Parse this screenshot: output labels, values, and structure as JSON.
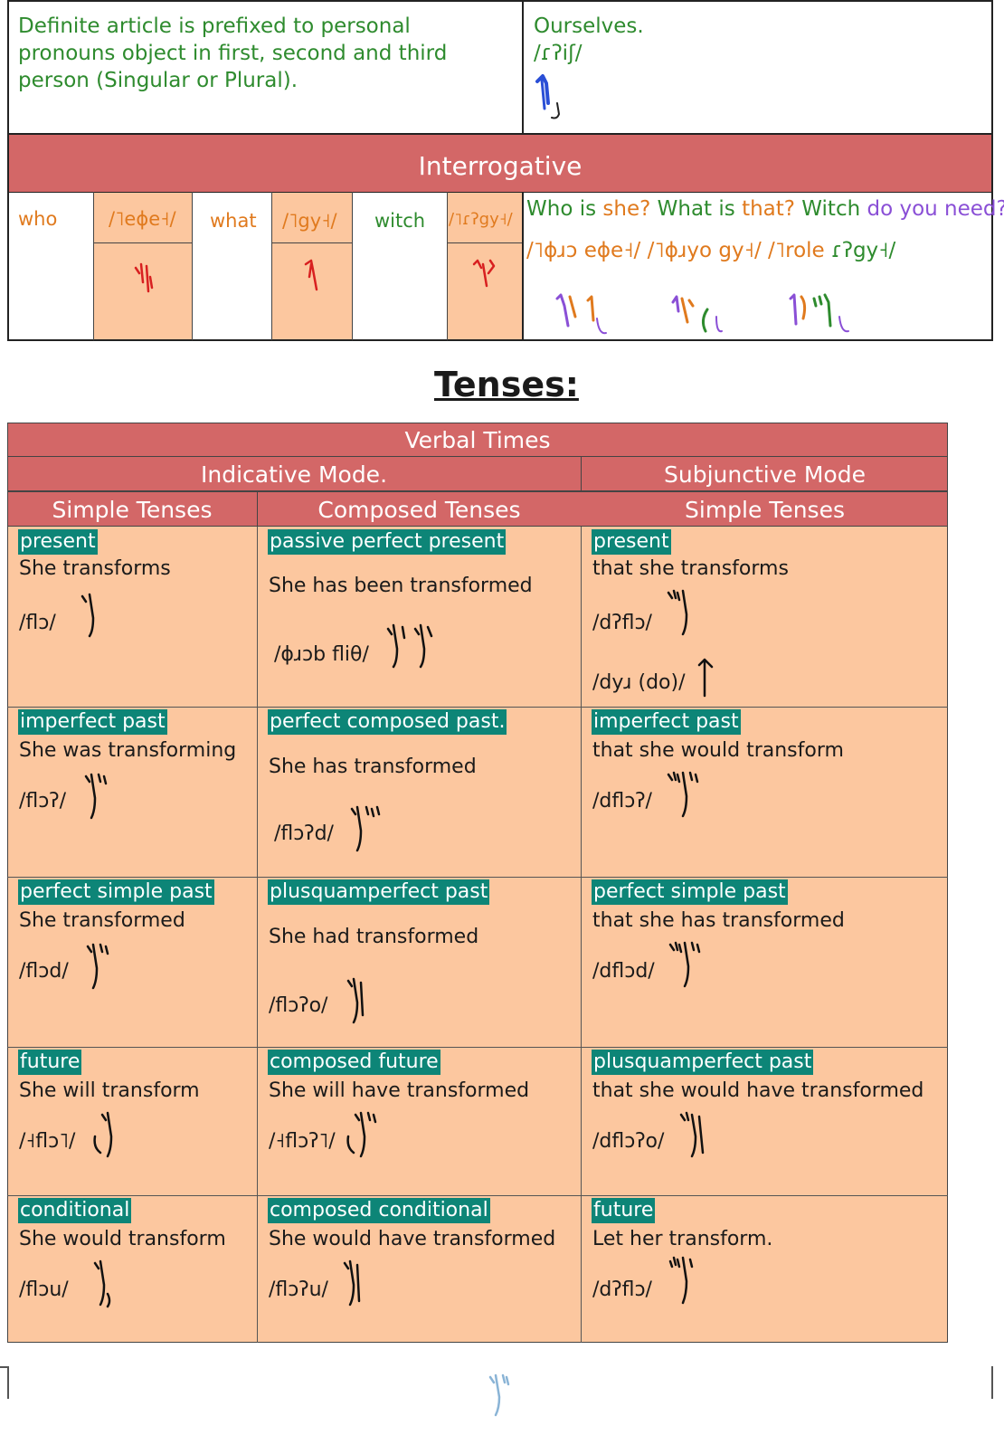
{
  "top_box": {
    "left_lines": [
      "Definite article is prefixed to personal",
      "pronouns object in first, second and third",
      "person (Singular or Plural)."
    ],
    "right_word": "Ourselves.",
    "right_ipa": "/ɾʔiʃ/",
    "right_glyph": "ourselves-glyph"
  },
  "interrogative": {
    "title": "Interrogative",
    "who": "who",
    "who_ipa": "/˥eɸe˧/",
    "what": "what",
    "what_ipa": "/˥gy˧/",
    "witch": "witch",
    "witch_ipa": "/˥ɾʔgy˧/",
    "example": {
      "who_is": "Who is",
      "she1": "she?",
      "what_is": "What is",
      "that": "that?",
      "witch": "Witch",
      "do_you_need": "do you need?"
    },
    "ipa_line": {
      "p1a": "/˥ɸɹɔ",
      "p1b": "eɸe˧/",
      "p2a": "/˥ɸɹyo",
      "p2b": "gy˧/",
      "p3a": "/˥role",
      "p3b": "ɾʔgy˧/"
    },
    "colors": {
      "green": "#2e8b2e",
      "orange": "#e07a1e",
      "purple": "#8a4fd6",
      "blue": "#2a4fd6"
    }
  },
  "tenses_heading": "Tenses:",
  "table": {
    "title": "Verbal Times",
    "indicative": "Indicative Mode.",
    "subjunctive": "Subjunctive Mode",
    "col_simple": "Simple Tenses",
    "col_composed": "Composed Tenses",
    "col_sub_simple": "Simple Tenses",
    "rows": [
      {
        "c1": {
          "tag": "present",
          "text": "She transforms",
          "ipa": "/flɔ/"
        },
        "c2": {
          "tag": "passive perfect present",
          "text": "She has been transformed",
          "ipa": "/ɸɹɔb fliθ/"
        },
        "c3": {
          "tag": "present",
          "text": "that she transforms",
          "ipa": "/dʔflɔ/",
          "ipa2": "/dyɹ (do)/"
        }
      },
      {
        "c1": {
          "tag": "imperfect past",
          "text": "She was transforming",
          "ipa": "/flɔʔ/"
        },
        "c2": {
          "tag": "perfect composed past.",
          "text": "She has transformed",
          "ipa": "/flɔʔd/"
        },
        "c3": {
          "tag": "imperfect past",
          "text": "that she would transform",
          "ipa": "/dflɔʔ/"
        }
      },
      {
        "c1": {
          "tag": "perfect simple past",
          "text": "She transformed",
          "ipa": "/flɔd/"
        },
        "c2": {
          "tag": "plusquamperfect past",
          "text": "She had transformed",
          "ipa": "/flɔʔo/"
        },
        "c3": {
          "tag": "perfect simple past",
          "text": "that she has transformed",
          "ipa": "/dflɔd/"
        }
      },
      {
        "c1": {
          "tag": "future",
          "text": "She will transform",
          "ipa": "/˧flɔ˥/"
        },
        "c2": {
          "tag": "composed future",
          "text": "She will have transformed",
          "ipa": "/˧flɔʔ˥/"
        },
        "c3": {
          "tag": "plusquamperfect past",
          "text": "that she would have transformed",
          "ipa": "/dflɔʔo/"
        }
      },
      {
        "c1": {
          "tag": "conditional",
          "text": "She would transform",
          "ipa": "/flɔu/"
        },
        "c2": {
          "tag": "composed conditional",
          "text": "She would have transformed",
          "ipa": "/flɔʔu/"
        },
        "c3": {
          "tag": "future",
          "text": "Let her transform.",
          "ipa": "/dʔflɔ/"
        }
      }
    ]
  },
  "footer_glyph": "page-mark-glyph"
}
